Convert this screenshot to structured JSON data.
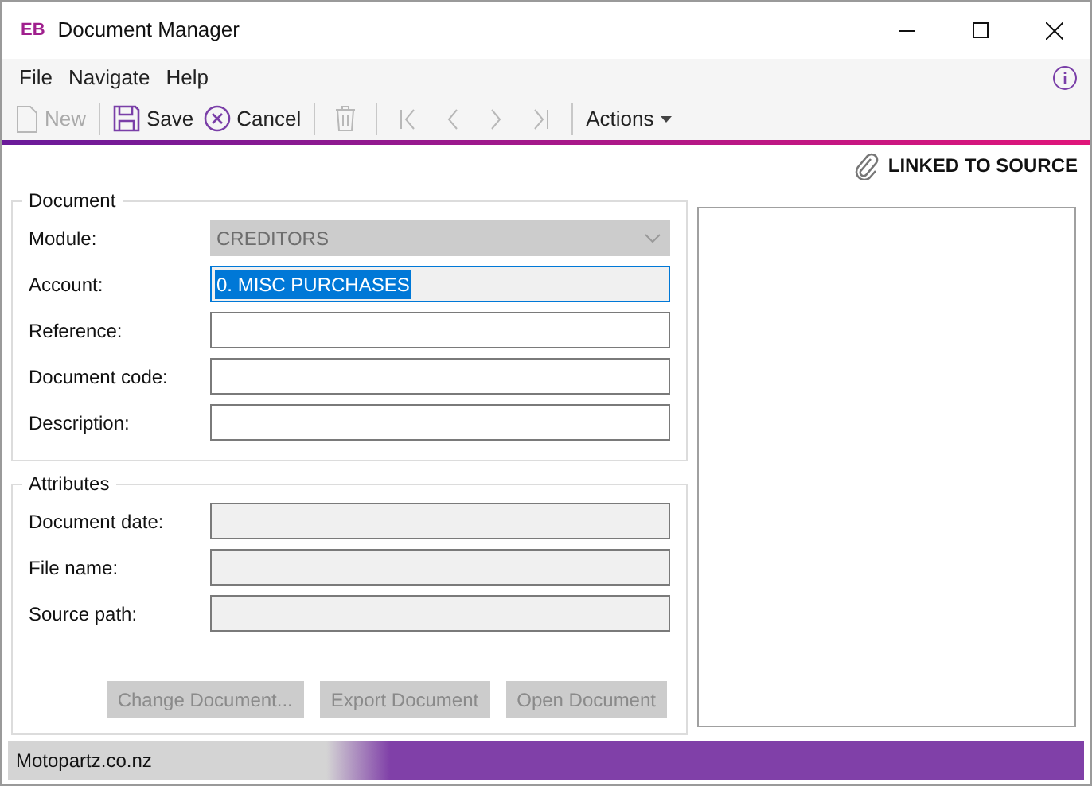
{
  "window": {
    "logo": "EB",
    "title": "Document Manager"
  },
  "menu": [
    {
      "label": "File"
    },
    {
      "label": "Navigate"
    },
    {
      "label": "Help"
    }
  ],
  "toolbar": [
    {
      "kind": "new",
      "label": "New",
      "disabled": true
    },
    {
      "kind": "separator"
    },
    {
      "kind": "save",
      "label": "Save",
      "disabled": false
    },
    {
      "kind": "cancel",
      "label": "Cancel",
      "disabled": false
    },
    {
      "kind": "separator"
    },
    {
      "kind": "delete",
      "disabled": true
    },
    {
      "kind": "separator"
    },
    {
      "kind": "first",
      "disabled": true
    },
    {
      "kind": "prev",
      "disabled": true
    },
    {
      "kind": "next",
      "disabled": true
    },
    {
      "kind": "last",
      "disabled": true
    },
    {
      "kind": "separator"
    },
    {
      "kind": "menu",
      "label": "Actions",
      "disabled": false
    }
  ],
  "link_status": "LINKED TO SOURCE",
  "document_group": {
    "title": "Document",
    "fields": [
      {
        "label": "Module:",
        "kind": "select",
        "value": "CREDITORS",
        "disabled": true,
        "focused": false
      },
      {
        "label": "Account:",
        "kind": "text",
        "value": "0. MISC PURCHASES",
        "disabled": false,
        "focused": true
      },
      {
        "label": "Reference:",
        "kind": "text",
        "disabled": false,
        "focused": false
      },
      {
        "label": "Document code:",
        "kind": "text",
        "disabled": false,
        "focused": false
      },
      {
        "label": "Description:",
        "kind": "text",
        "disabled": false,
        "focused": false
      }
    ]
  },
  "attributes_group": {
    "title": "Attributes",
    "fields": [
      {
        "label": "Document date:",
        "kind": "text",
        "disabled": true,
        "focused": false
      },
      {
        "label": "File name:",
        "kind": "text",
        "disabled": true,
        "focused": false
      },
      {
        "label": "Source path:",
        "kind": "text",
        "disabled": true,
        "focused": false
      }
    ]
  },
  "buttons": [
    {
      "label": "Change Document...",
      "disabled": true
    },
    {
      "label": "Export Document",
      "disabled": true
    },
    {
      "label": "Open Document",
      "disabled": true
    }
  ],
  "status_bar": {
    "text": "Motopartz.co.nz"
  }
}
